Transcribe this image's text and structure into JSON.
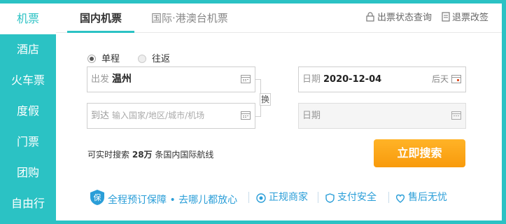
{
  "sidebar": {
    "items": [
      {
        "label": "机票",
        "active": true
      },
      {
        "label": "酒店",
        "active": false
      },
      {
        "label": "火车票",
        "active": false
      },
      {
        "label": "度假",
        "active": false
      },
      {
        "label": "门票",
        "active": false
      },
      {
        "label": "团购",
        "active": false
      },
      {
        "label": "自由行",
        "active": false
      }
    ]
  },
  "tabs": {
    "domestic": "国内机票",
    "international": "国际·港澳台机票"
  },
  "toplinks": {
    "status": "出票状态查询",
    "refund": "退票改签"
  },
  "trip_type": {
    "one_way": "单程",
    "round_trip": "往返",
    "selected": "单程"
  },
  "form": {
    "from_label": "出发",
    "from_value": "温州",
    "to_label": "到达",
    "to_placeholder": "输入国家/地区/城市/机场",
    "swap": "换",
    "date_label": "日期",
    "date_value": "2020-12-04",
    "date_hint": "后天",
    "return_label": "日期"
  },
  "stats": {
    "prefix": "可实时搜索",
    "count": "28万",
    "suffix": "条国内国际航线"
  },
  "search_button": "立即搜索",
  "guarantees": {
    "badge": "保",
    "main": "全程预订保障 • 去哪儿都放心",
    "merchant": "正规商家",
    "payment": "支付安全",
    "aftersale": "售后无忧"
  },
  "colors": {
    "brand": "#2bc2c4",
    "search": "#f89a0c",
    "link": "#2a9ed8"
  }
}
